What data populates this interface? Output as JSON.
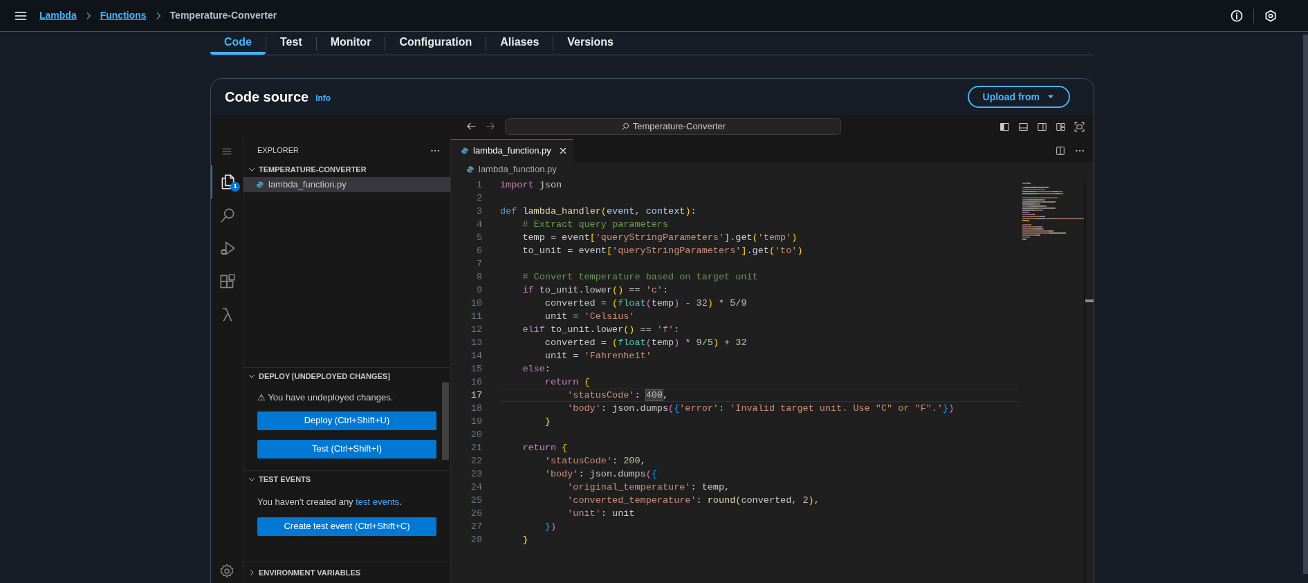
{
  "breadcrumbs": [
    {
      "label": "Lambda",
      "kind": "link"
    },
    {
      "label": "Functions",
      "kind": "link"
    },
    {
      "label": "Temperature-Converter",
      "kind": "current"
    }
  ],
  "tabs": [
    {
      "label": "Code",
      "selected": true
    },
    {
      "label": "Test",
      "selected": false
    },
    {
      "label": "Monitor",
      "selected": false
    },
    {
      "label": "Configuration",
      "selected": false
    },
    {
      "label": "Aliases",
      "selected": false
    },
    {
      "label": "Versions",
      "selected": false
    }
  ],
  "code_source": {
    "title": "Code source",
    "info_link": "Info",
    "upload_button": "Upload from",
    "editor": {
      "search": "Temperature-Converter",
      "activity_bar": [
        {
          "selected": true,
          "badge": "1"
        },
        {
          "selected": false
        },
        {
          "selected": false
        },
        {
          "selected": false
        },
        {
          "selected": false
        }
      ],
      "explorer": {
        "title": "EXPLORER",
        "folder": {
          "name": "TEMPERATURE-CONVERTER",
          "expanded": true,
          "files": [
            {
              "name": "lambda_function.py",
              "selected": true
            }
          ]
        }
      },
      "deploy": {
        "title": "DEPLOY [UNDEPLOYED CHANGES]",
        "expanded": true,
        "message": "⚠ You have undeployed changes.",
        "buttons": [
          "Deploy (Ctrl+Shift+U)",
          "Test (Ctrl+Shift+I)"
        ]
      },
      "test_events": {
        "title": "TEST EVENTS",
        "expanded": true,
        "message_before": "You haven't created any ",
        "link": "test events",
        "message_after": ".",
        "button": "Create test event (Ctrl+Shift+C)"
      },
      "environment_variables": {
        "title": "ENVIRONMENT VARIABLES",
        "expanded": false
      },
      "open_tabs": [
        {
          "label": "lambda_function.py",
          "selected": true
        }
      ],
      "file_breadcrumb": "lambda_function.py",
      "code_lines": [
        {
          "number": "1",
          "current": false,
          "tokens": [
            {
              "text": "import",
              "kind": "kw"
            },
            {
              "text": " json",
              "kind": "plain"
            }
          ]
        },
        {
          "number": "2",
          "current": false
        },
        {
          "number": "3",
          "current": false,
          "tokens": [
            {
              "text": "def",
              "kind": "def"
            },
            {
              "text": " lambda_handler",
              "kind": "fn"
            },
            {
              "text": "(",
              "kind": "p1"
            },
            {
              "text": "event",
              "kind": "param"
            },
            {
              "text": ", ",
              "kind": "plain"
            },
            {
              "text": "context",
              "kind": "param"
            },
            {
              "text": ")",
              "kind": "p1"
            },
            {
              "text": ":",
              "kind": "plain"
            }
          ]
        },
        {
          "number": "4",
          "current": false,
          "tokens": [
            {
              "text": "    # Extract query parameters",
              "kind": "cm"
            }
          ]
        },
        {
          "number": "5",
          "current": false,
          "tokens": [
            {
              "text": "    temp = event",
              "kind": "plain"
            },
            {
              "text": "[",
              "kind": "p1"
            },
            {
              "text": "'queryStringParameters'",
              "kind": "str"
            },
            {
              "text": "]",
              "kind": "p1"
            },
            {
              "text": ".get",
              "kind": "plain"
            },
            {
              "text": "(",
              "kind": "p1"
            },
            {
              "text": "'temp'",
              "kind": "str"
            },
            {
              "text": ")",
              "kind": "p1"
            }
          ]
        },
        {
          "number": "6",
          "current": false,
          "tokens": [
            {
              "text": "    to_unit = event",
              "kind": "plain"
            },
            {
              "text": "[",
              "kind": "p1"
            },
            {
              "text": "'queryStringParameters'",
              "kind": "str"
            },
            {
              "text": "]",
              "kind": "p1"
            },
            {
              "text": ".get",
              "kind": "plain"
            },
            {
              "text": "(",
              "kind": "p1"
            },
            {
              "text": "'to'",
              "kind": "str"
            },
            {
              "text": ")",
              "kind": "p1"
            }
          ]
        },
        {
          "number": "7",
          "current": false
        },
        {
          "number": "8",
          "current": false,
          "tokens": [
            {
              "text": "    # Convert temperature based on target unit",
              "kind": "cm"
            }
          ]
        },
        {
          "number": "9",
          "current": false,
          "tokens": [
            {
              "text": "    if",
              "kind": "kw"
            },
            {
              "text": " to_unit.lower",
              "kind": "plain"
            },
            {
              "text": "()",
              "kind": "p1"
            },
            {
              "text": " == ",
              "kind": "plain"
            },
            {
              "text": "'c'",
              "kind": "str"
            },
            {
              "text": ":",
              "kind": "plain"
            }
          ]
        },
        {
          "number": "10",
          "current": false,
          "tokens": [
            {
              "text": "        converted = ",
              "kind": "plain"
            },
            {
              "text": "(",
              "kind": "p1"
            },
            {
              "text": "float",
              "kind": "cls"
            },
            {
              "text": "(",
              "kind": "p2"
            },
            {
              "text": "temp",
              "kind": "plain"
            },
            {
              "text": ")",
              "kind": "p2"
            },
            {
              "text": " - ",
              "kind": "plain"
            },
            {
              "text": "32",
              "kind": "num"
            },
            {
              "text": ")",
              "kind": "p1"
            },
            {
              "text": " * ",
              "kind": "plain"
            },
            {
              "text": "5/9",
              "kind": "num"
            }
          ]
        },
        {
          "number": "11",
          "current": false,
          "tokens": [
            {
              "text": "        unit = ",
              "kind": "plain"
            },
            {
              "text": "'Celsius'",
              "kind": "str"
            }
          ]
        },
        {
          "number": "12",
          "current": false,
          "tokens": [
            {
              "text": "    elif",
              "kind": "kw"
            },
            {
              "text": " to_unit.lower",
              "kind": "plain"
            },
            {
              "text": "()",
              "kind": "p1"
            },
            {
              "text": " == ",
              "kind": "plain"
            },
            {
              "text": "'f'",
              "kind": "str"
            },
            {
              "text": ":",
              "kind": "plain"
            }
          ]
        },
        {
          "number": "13",
          "current": false,
          "tokens": [
            {
              "text": "        converted = ",
              "kind": "plain"
            },
            {
              "text": "(",
              "kind": "p1"
            },
            {
              "text": "float",
              "kind": "cls"
            },
            {
              "text": "(",
              "kind": "p2"
            },
            {
              "text": "temp",
              "kind": "plain"
            },
            {
              "text": ")",
              "kind": "p2"
            },
            {
              "text": " * ",
              "kind": "plain"
            },
            {
              "text": "9/5",
              "kind": "num"
            },
            {
              "text": ")",
              "kind": "p1"
            },
            {
              "text": " + ",
              "kind": "plain"
            },
            {
              "text": "32",
              "kind": "num"
            }
          ]
        },
        {
          "number": "14",
          "current": false,
          "tokens": [
            {
              "text": "        unit = ",
              "kind": "plain"
            },
            {
              "text": "'Fahrenheit'",
              "kind": "str"
            }
          ]
        },
        {
          "number": "15",
          "current": false,
          "tokens": [
            {
              "text": "    else",
              "kind": "kw"
            },
            {
              "text": ":",
              "kind": "plain"
            }
          ]
        },
        {
          "number": "16",
          "current": false,
          "tokens": [
            {
              "text": "        return",
              "kind": "kw"
            },
            {
              "text": " {",
              "kind": "p1"
            }
          ]
        },
        {
          "number": "17",
          "current": true,
          "tokens": [
            {
              "text": "            'statusCode'",
              "kind": "str"
            },
            {
              "text": ": ",
              "kind": "plain"
            },
            {
              "text": "400",
              "kind": "match"
            },
            {
              "text": ",",
              "kind": "plain"
            }
          ]
        },
        {
          "number": "18",
          "current": false,
          "tokens": [
            {
              "text": "            'body'",
              "kind": "str"
            },
            {
              "text": ": json.dumps",
              "kind": "plain"
            },
            {
              "text": "(",
              "kind": "p2"
            },
            {
              "text": "{",
              "kind": "p3"
            },
            {
              "text": "'error'",
              "kind": "str"
            },
            {
              "text": ": ",
              "kind": "plain"
            },
            {
              "text": "'Invalid target unit. Use \"C\" or \"F\".'",
              "kind": "str"
            },
            {
              "text": "}",
              "kind": "p3"
            },
            {
              "text": ")",
              "kind": "p2"
            }
          ]
        },
        {
          "number": "19",
          "current": false,
          "tokens": [
            {
              "text": "        }",
              "kind": "p1"
            }
          ]
        },
        {
          "number": "20",
          "current": false
        },
        {
          "number": "21",
          "current": false,
          "tokens": [
            {
              "text": "    return",
              "kind": "kw"
            },
            {
              "text": " {",
              "kind": "p1"
            }
          ]
        },
        {
          "number": "22",
          "current": false,
          "tokens": [
            {
              "text": "        'statusCode'",
              "kind": "str"
            },
            {
              "text": ": ",
              "kind": "plain"
            },
            {
              "text": "200",
              "kind": "num"
            },
            {
              "text": ",",
              "kind": "plain"
            }
          ]
        },
        {
          "number": "23",
          "current": false,
          "tokens": [
            {
              "text": "        'body'",
              "kind": "str"
            },
            {
              "text": ": json.dumps",
              "kind": "plain"
            },
            {
              "text": "(",
              "kind": "p2"
            },
            {
              "text": "{",
              "kind": "p3"
            }
          ]
        },
        {
          "number": "24",
          "current": false,
          "tokens": [
            {
              "text": "            'original_temperature'",
              "kind": "str"
            },
            {
              "text": ": temp,",
              "kind": "plain"
            }
          ]
        },
        {
          "number": "25",
          "current": false,
          "tokens": [
            {
              "text": "            'converted_temperature'",
              "kind": "str"
            },
            {
              "text": ": ",
              "kind": "plain"
            },
            {
              "text": "round",
              "kind": "fn"
            },
            {
              "text": "(",
              "kind": "p1"
            },
            {
              "text": "converted, ",
              "kind": "plain"
            },
            {
              "text": "2",
              "kind": "num"
            },
            {
              "text": ")",
              "kind": "p1"
            },
            {
              "text": ",",
              "kind": "plain"
            }
          ]
        },
        {
          "number": "26",
          "current": false,
          "tokens": [
            {
              "text": "            'unit'",
              "kind": "str"
            },
            {
              "text": ": unit",
              "kind": "plain"
            }
          ]
        },
        {
          "number": "27",
          "current": false,
          "tokens": [
            {
              "text": "        }",
              "kind": "p3"
            },
            {
              "text": ")",
              "kind": "p2"
            }
          ]
        },
        {
          "number": "28",
          "current": false,
          "tokens": [
            {
              "text": "    }",
              "kind": "p1"
            }
          ]
        }
      ]
    }
  }
}
